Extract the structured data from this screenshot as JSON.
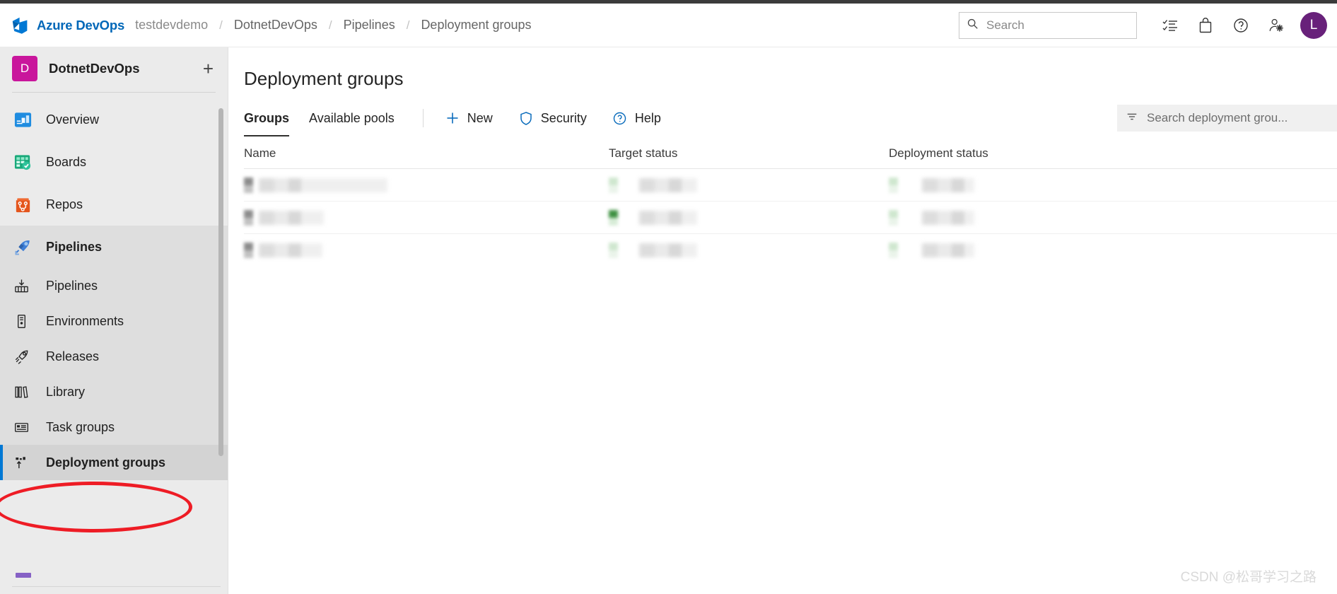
{
  "header": {
    "brand": "Azure DevOps",
    "logo_icon": "azure-devops-logo-icon",
    "breadcrumbs": [
      {
        "label": "testdevdemo",
        "muted": true
      },
      {
        "label": "DotnetDevOps",
        "muted": false
      },
      {
        "label": "Pipelines",
        "muted": false
      },
      {
        "label": "Deployment groups",
        "muted": false
      }
    ],
    "separator": "/",
    "search": {
      "placeholder": "Search",
      "value": "",
      "icon": "search-icon"
    },
    "icons": [
      {
        "name": "boards-tasks-icon",
        "title": "Boards"
      },
      {
        "name": "marketplace-bag-icon",
        "title": "Marketplace"
      },
      {
        "name": "help-question-icon",
        "title": "Help"
      },
      {
        "name": "user-settings-icon",
        "title": "User settings"
      }
    ],
    "avatar": {
      "initial": "L",
      "color": "#68217a"
    }
  },
  "sidebar": {
    "project": {
      "badge_letter": "D",
      "name": "DotnetDevOps",
      "badge_color": "#c9169c"
    },
    "add_label": "+",
    "items": [
      {
        "label": "Overview",
        "icon": "overview-icon"
      },
      {
        "label": "Boards",
        "icon": "boards-icon"
      },
      {
        "label": "Repos",
        "icon": "repos-icon"
      }
    ],
    "hub": {
      "label": "Pipelines",
      "icon": "pipelines-rocket-icon",
      "children": [
        {
          "label": "Pipelines",
          "icon": "pipelines-build-icon",
          "selected": false
        },
        {
          "label": "Environments",
          "icon": "environments-server-icon",
          "selected": false
        },
        {
          "label": "Releases",
          "icon": "releases-rocket-icon",
          "selected": false
        },
        {
          "label": "Library",
          "icon": "library-books-icon",
          "selected": false
        },
        {
          "label": "Task groups",
          "icon": "task-groups-icon",
          "selected": false
        },
        {
          "label": "Deployment groups",
          "icon": "deployment-groups-icon",
          "selected": true
        }
      ]
    }
  },
  "main": {
    "title": "Deployment groups",
    "tabs": [
      {
        "label": "Groups",
        "active": true
      },
      {
        "label": "Available pools",
        "active": false
      }
    ],
    "actions": [
      {
        "label": "New",
        "icon": "plus-icon"
      },
      {
        "label": "Security",
        "icon": "shield-icon"
      },
      {
        "label": "Help",
        "icon": "help-circle-icon"
      }
    ],
    "filter": {
      "placeholder": "Search deployment grou...",
      "value": "",
      "icon": "filter-icon"
    },
    "table": {
      "columns": [
        "Name",
        "Target status",
        "Deployment status"
      ],
      "rows": [
        {
          "name_redacted": true,
          "target_redacted": true,
          "deploy_redacted": true,
          "target_state": "neutral"
        },
        {
          "name_redacted": true,
          "target_redacted": true,
          "deploy_redacted": true,
          "target_state": "success"
        },
        {
          "name_redacted": true,
          "target_redacted": true,
          "deploy_redacted": true,
          "target_state": "neutral"
        }
      ]
    }
  },
  "watermark": "CSDN @松哥学习之路",
  "colors": {
    "accent": "#0078d4",
    "brand_blue": "#0067b8",
    "sidebar_bg": "#ebebeb",
    "hub_bg": "#dedede",
    "selected_bg": "#d3d3d3",
    "annotation_red": "#ee1c25"
  }
}
